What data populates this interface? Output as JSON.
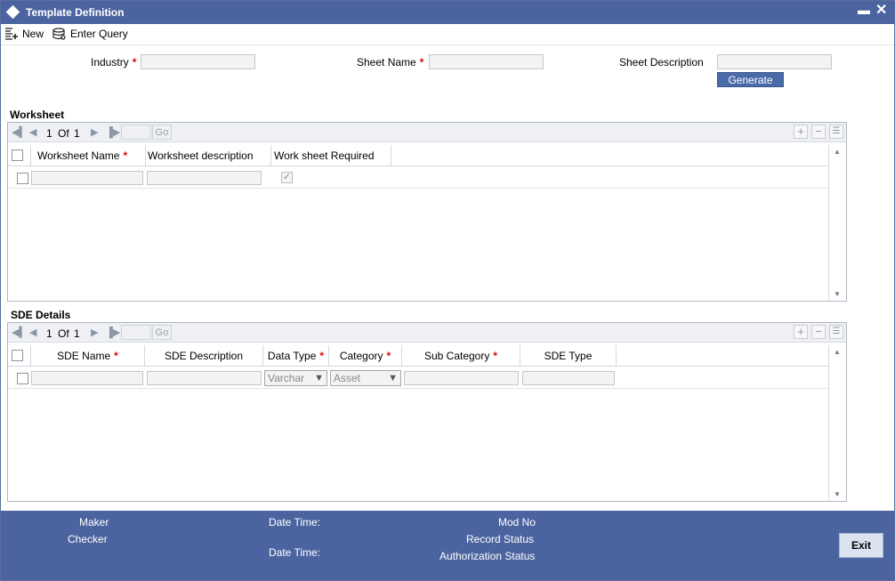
{
  "window": {
    "title": "Template Definition"
  },
  "toolbar": {
    "new_label": "New",
    "enter_query_label": "Enter Query"
  },
  "form": {
    "industry_label": "Industry",
    "sheet_name_label": "Sheet Name",
    "sheet_description_label": "Sheet Description",
    "required_mark": "*",
    "generate_label": "Generate"
  },
  "worksheet": {
    "title": "Worksheet",
    "pager": {
      "current": "1",
      "of_label": "Of",
      "total": "1",
      "go_label": "Go"
    },
    "columns": [
      "Worksheet Name",
      "Worksheet description",
      "Work sheet Required"
    ]
  },
  "sde": {
    "title": "SDE Details",
    "pager": {
      "current": "1",
      "of_label": "Of",
      "total": "1",
      "go_label": "Go"
    },
    "columns": [
      "SDE Name",
      "SDE Description",
      "Data Type",
      "Category",
      "Sub Category",
      "SDE Type"
    ],
    "row": {
      "data_type": "Varchar",
      "category": "Asset"
    }
  },
  "footer": {
    "maker_label": "Maker",
    "checker_label": "Checker",
    "date_time_label": "Date Time:",
    "mod_no_label": "Mod No",
    "record_status_label": "Record Status",
    "authorization_status_label": "Authorization Status",
    "exit_label": "Exit"
  },
  "colors": {
    "titlebar": "#4b64a0",
    "footer": "#4b64a0",
    "required": "#dd0000"
  }
}
